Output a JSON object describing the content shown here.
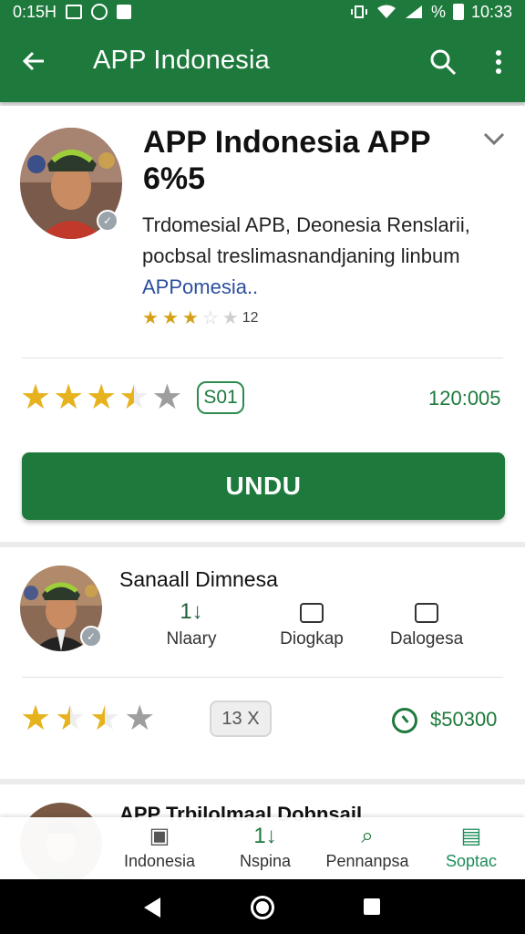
{
  "status_bar": {
    "time_left": "0:15H",
    "battery_label": "%",
    "time_right": "10:33"
  },
  "app_bar": {
    "title": "APP Indonesia"
  },
  "main_card": {
    "title": "APP Indonesia APP 6%5",
    "description_line1": "Trdomesial APB, Deonesia Renslarii,",
    "description_line2": "pocbsal treslimasnandjaning linbum",
    "description_link": "APPomesia..",
    "mini_rating_count": "12",
    "rating_stars": 3.5,
    "version_pill": "S01",
    "downloads": "120:005",
    "install_button": "UNDU"
  },
  "developer_card": {
    "name": "Sanaall Dimnesa",
    "stats": [
      {
        "top": "1↓",
        "label": "Nlaary"
      },
      {
        "top": "",
        "label": "Diogkap"
      },
      {
        "top": "",
        "label": "Dalogesa"
      }
    ],
    "rating_stars": 2.5,
    "pill": "13 X",
    "price": "$50300"
  },
  "third_card": {
    "title": "APP Trbilolmaal Dobnsail"
  },
  "bottom_nav": [
    {
      "label": "Indonesia",
      "icon": "building-icon"
    },
    {
      "label": "Nspina",
      "icon": "sort-icon"
    },
    {
      "label": "Pennanpsa",
      "icon": "search-icon"
    },
    {
      "label": "Soptac",
      "icon": "document-icon"
    }
  ],
  "colors": {
    "primary": "#1e7a3c",
    "star": "#e6b31e",
    "link": "#2b4f9c"
  }
}
